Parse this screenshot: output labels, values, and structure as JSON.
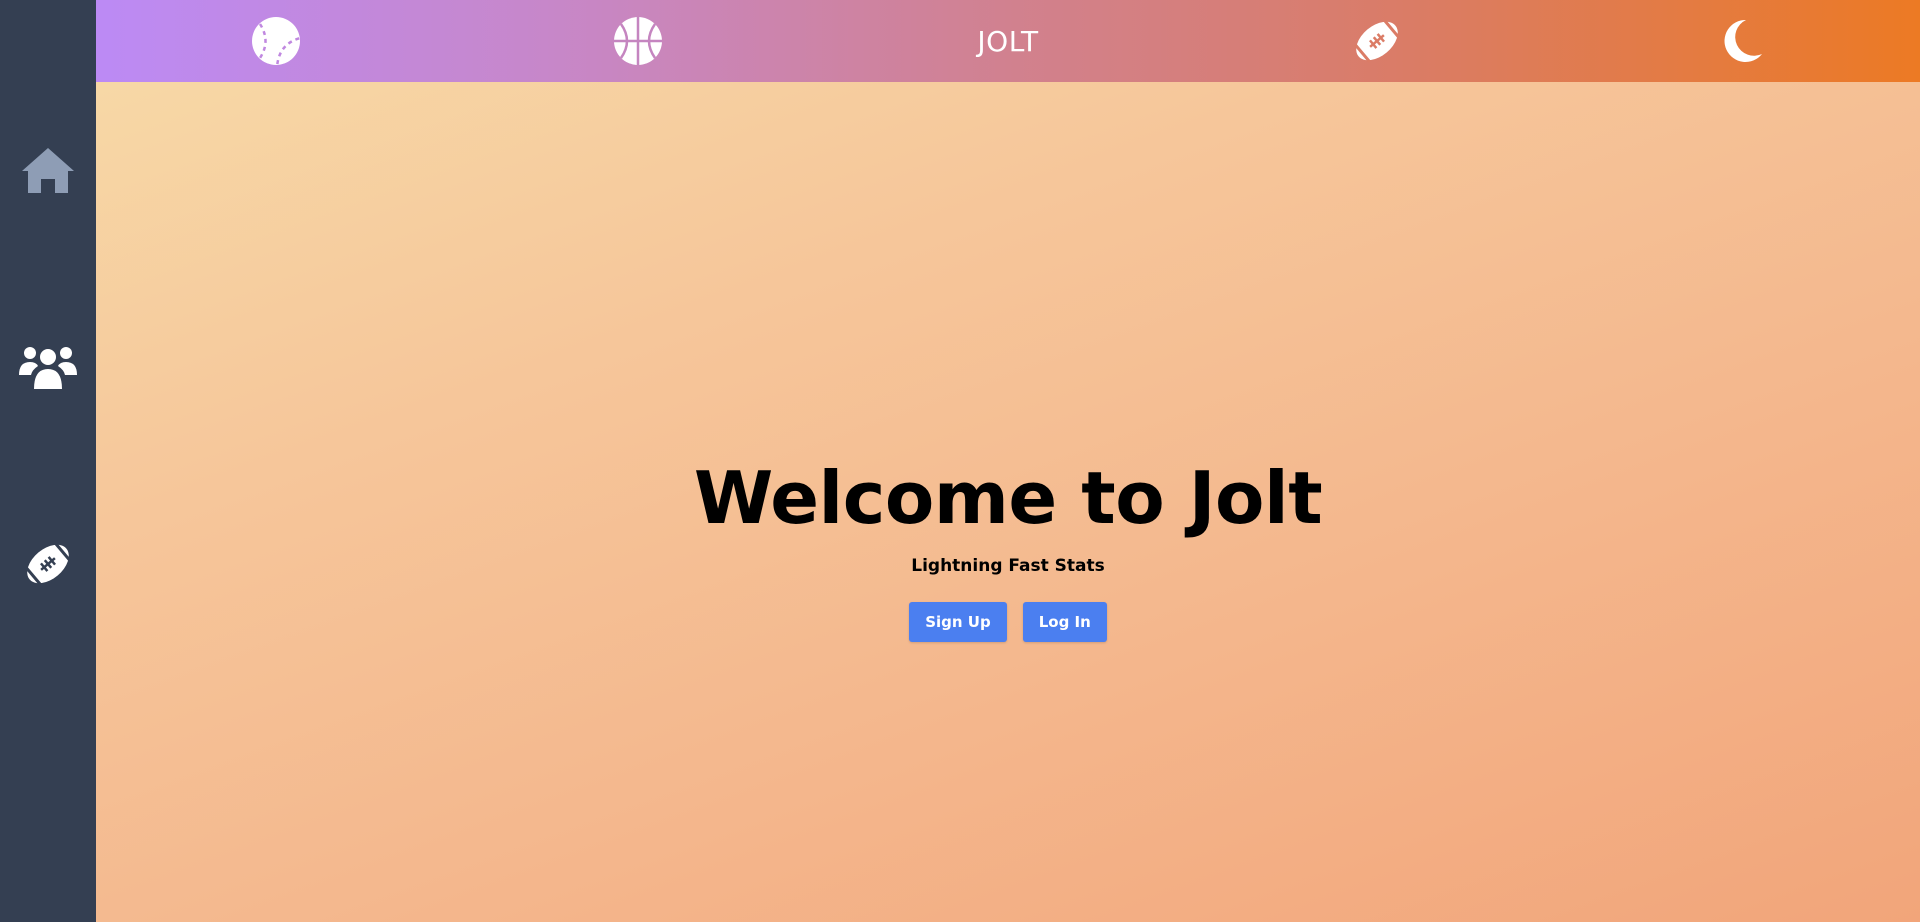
{
  "topbar": {
    "brand": "JOLT",
    "icons": [
      "baseball-icon",
      "basketball-icon",
      "football-icon",
      "moon-icon"
    ],
    "gradient": [
      "#bc8af5",
      "#ec7a24"
    ]
  },
  "sidebar": {
    "background": "#343f52",
    "items": [
      {
        "icon": "home-icon",
        "active": true
      },
      {
        "icon": "users-icon",
        "active": false
      },
      {
        "icon": "football-icon",
        "active": false
      }
    ]
  },
  "hero": {
    "title": "Welcome to Jolt",
    "tagline": "Lightning Fast Stats"
  },
  "buttons": {
    "signup": "Sign Up",
    "login": "Log In",
    "color": "#4b7ff0"
  }
}
